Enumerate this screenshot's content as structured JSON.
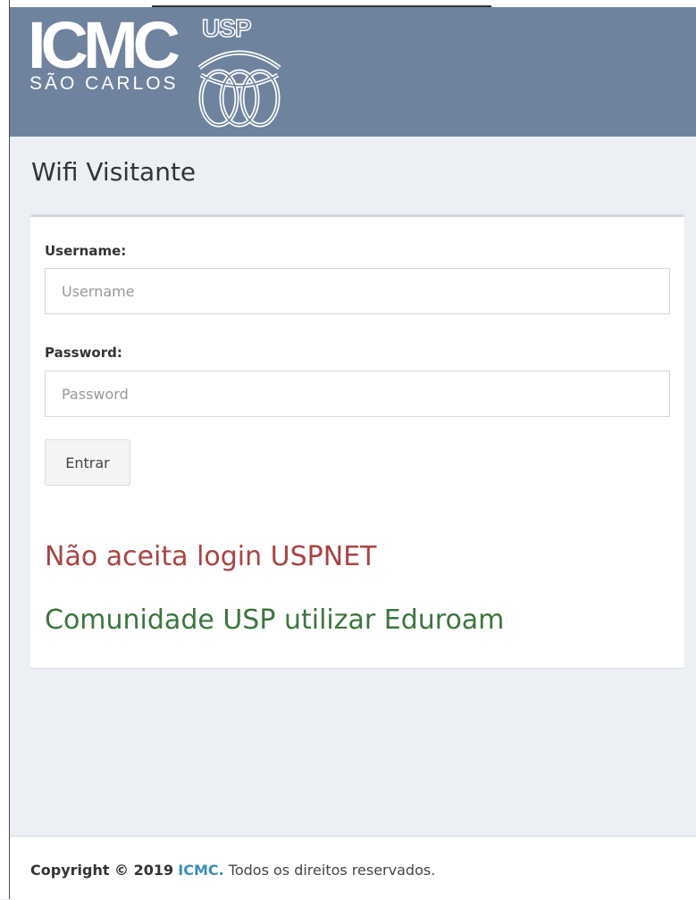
{
  "header": {
    "logo": {
      "main_text": "ICMC",
      "sub_text": "SÃO CARLOS",
      "badge_text": "USP",
      "emblem_icon": "usp-knot-emblem"
    }
  },
  "page_title": "Wifi Visitante",
  "login_form": {
    "username_label": "Username:",
    "username_placeholder": "Username",
    "username_value": "",
    "password_label": "Password:",
    "password_placeholder": "Password",
    "password_value": "",
    "submit_label": "Entrar"
  },
  "notices": {
    "warning_text": "Não aceita login USPNET",
    "warning_color": "#a94442",
    "info_text": "Comunidade USP utilizar Eduroam",
    "info_color": "#3c763d"
  },
  "footer": {
    "copyright_prefix": "Copyright © 2019",
    "link_text": "ICMC.",
    "suffix": "Todos os direitos reservados.",
    "link_color": "#3c8dbc"
  },
  "colors": {
    "header_bg": "#6f839e",
    "page_bg": "#ecf0f5"
  }
}
